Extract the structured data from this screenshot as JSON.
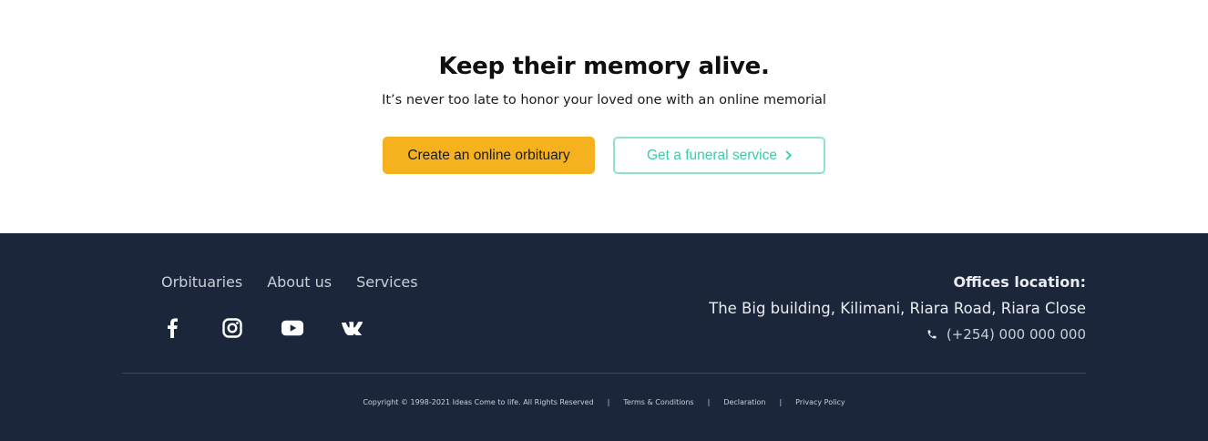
{
  "cta": {
    "title": "Keep their memory alive.",
    "subtitle": "It’s never too late to honor your loved one with an online memorial",
    "primary_button": "Create an online orbituary",
    "secondary_button": "Get a funeral service",
    "secondary_icon": "chevron-right-icon"
  },
  "footer": {
    "nav": [
      "Orbituaries",
      "About us",
      "Services"
    ],
    "social": [
      "facebook-icon",
      "instagram-icon",
      "youtube-icon",
      "vk-icon"
    ],
    "office_heading": "Offices location:",
    "office_address": "The Big building, Kilimani, Riara Road, Riara Close",
    "phone": "(+254) 000 000 000",
    "phone_icon": "phone-icon",
    "copyright": "Copyright © 1998-2021 Ideas Come to life. All Rights Reserved",
    "legal_links": [
      "Terms & Conditions",
      "Declaration",
      "Privacy Policy"
    ],
    "separator": "|"
  },
  "colors": {
    "accent_yellow": "#f6b11e",
    "accent_teal": "#3fcaa6",
    "footer_bg": "#1b263a"
  }
}
